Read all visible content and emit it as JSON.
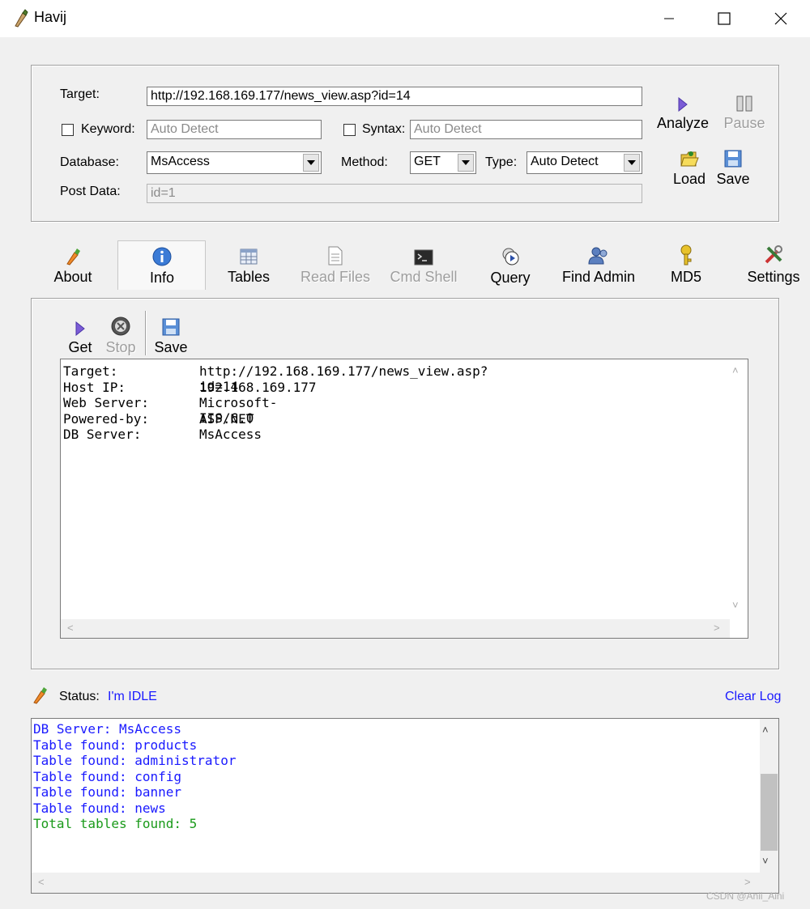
{
  "window": {
    "title": "Havij"
  },
  "form": {
    "target_label": "Target:",
    "target_value": "http://192.168.169.177/news_view.asp?id=14",
    "keyword_label": "Keyword:",
    "keyword_placeholder": "Auto Detect",
    "syntax_label": "Syntax:",
    "syntax_placeholder": "Auto Detect",
    "database_label": "Database:",
    "database_value": "MsAccess",
    "method_label": "Method:",
    "method_value": "GET",
    "type_label": "Type:",
    "type_value": "Auto Detect",
    "postdata_label": "Post Data:",
    "postdata_value": "id=1"
  },
  "actions": {
    "analyze": "Analyze",
    "pause": "Pause",
    "load": "Load",
    "save": "Save"
  },
  "tabs": [
    {
      "label": "About"
    },
    {
      "label": "Info"
    },
    {
      "label": "Tables"
    },
    {
      "label": "Read Files"
    },
    {
      "label": "Cmd Shell"
    },
    {
      "label": "Query"
    },
    {
      "label": "Find Admin"
    },
    {
      "label": "MD5"
    },
    {
      "label": "Settings"
    }
  ],
  "info_toolbar": {
    "get": "Get",
    "stop": "Stop",
    "save": "Save"
  },
  "info": {
    "rows": [
      {
        "key": "Target:",
        "value": "http://192.168.169.177/news_view.asp?id=14"
      },
      {
        "key": "Host IP:",
        "value": "192.168.169.177"
      },
      {
        "key": "Web Server:",
        "value": "Microsoft-IIS/6.0"
      },
      {
        "key": "Powered-by:",
        "value": "ASP.NET"
      },
      {
        "key": "DB Server:",
        "value": "MsAccess"
      }
    ]
  },
  "status": {
    "label": "Status:",
    "value": "I'm IDLE",
    "clear_log": "Clear Log"
  },
  "log": {
    "lines": [
      {
        "text": "DB Server: MsAccess",
        "color": "#1a1aff"
      },
      {
        "text": "Table found: products",
        "color": "#1a1aff"
      },
      {
        "text": "Table found: administrator",
        "color": "#1a1aff"
      },
      {
        "text": "Table found: config",
        "color": "#1a1aff"
      },
      {
        "text": "Table found: banner",
        "color": "#1a1aff"
      },
      {
        "text": "Table found: news",
        "color": "#1a1aff"
      },
      {
        "text": "Total tables found: 5",
        "color": "#1a9a1a"
      }
    ]
  },
  "watermark": "CSDN @Anii_Aini"
}
